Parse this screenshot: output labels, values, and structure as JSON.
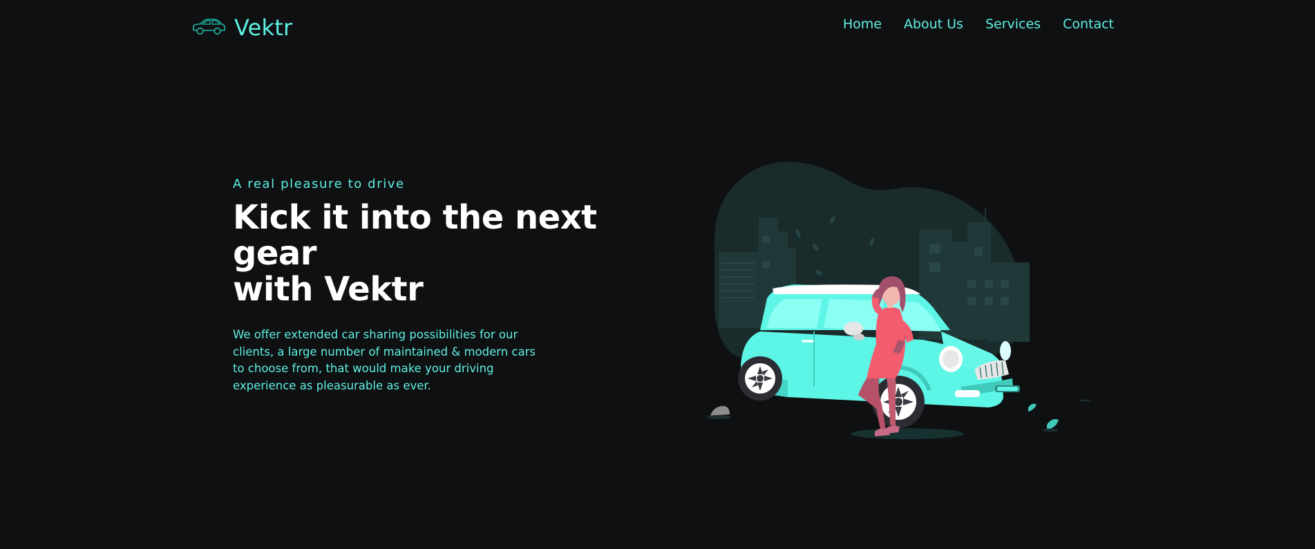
{
  "brand": {
    "name": "Vektr",
    "icon": "car-icon"
  },
  "nav": {
    "items": [
      {
        "label": "Home"
      },
      {
        "label": "About Us"
      },
      {
        "label": "Services"
      },
      {
        "label": "Contact"
      }
    ]
  },
  "hero": {
    "eyebrow": "A real pleasure to drive",
    "headline_line1": "Kick it into the next gear",
    "headline_line2": "with Vektr",
    "description": "We offer extended car sharing possibilities for our clients, a large number of maintained & modern cars to choose from, that would make your driving experience as pleasurable as ever."
  },
  "colors": {
    "background": "#0f1012",
    "accent": "#5ff1e4",
    "heading": "#ffffff",
    "illustration_blob": "#1a2b2b",
    "car": "#5ff5e6",
    "figure_dress": "#f25c6e"
  }
}
